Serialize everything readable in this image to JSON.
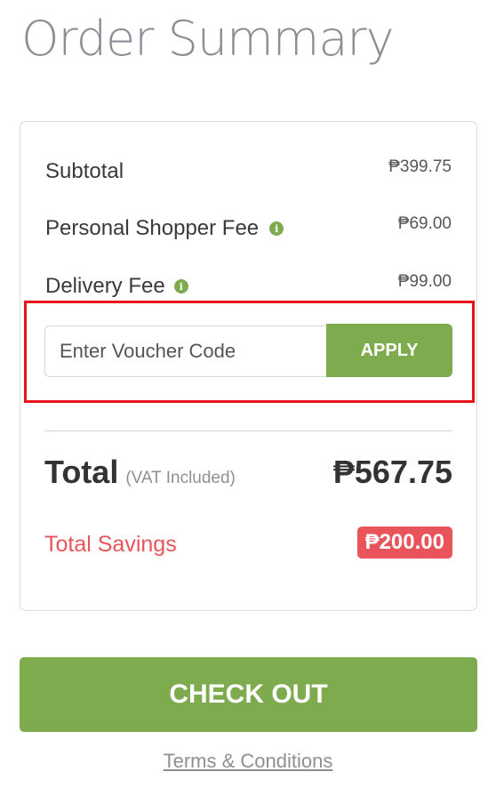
{
  "page": {
    "title": "Order Summary"
  },
  "summary": {
    "lines": [
      {
        "label": "Subtotal",
        "amount": "₱399.75",
        "has_info": false
      },
      {
        "label": "Personal Shopper Fee",
        "amount": "₱69.00",
        "has_info": true
      },
      {
        "label": "Delivery Fee",
        "amount": "₱99.00",
        "has_info": true
      }
    ],
    "info_icon_glyph": "i",
    "voucher": {
      "placeholder": "Enter Voucher Code",
      "value": "",
      "apply_label": "APPLY"
    },
    "total": {
      "label": "Total",
      "note": "(VAT Included)",
      "amount": "₱567.75"
    },
    "savings": {
      "label": "Total Savings",
      "amount": "₱200.00"
    }
  },
  "actions": {
    "checkout_label": "CHECK OUT",
    "terms_label": "Terms & Conditions"
  },
  "colors": {
    "accent_green": "#7dab4e",
    "savings_red": "#e8545a",
    "highlight_red": "#e8141a",
    "title_gray": "#8a8f96"
  },
  "icons": {
    "info": "info-circle-icon"
  }
}
